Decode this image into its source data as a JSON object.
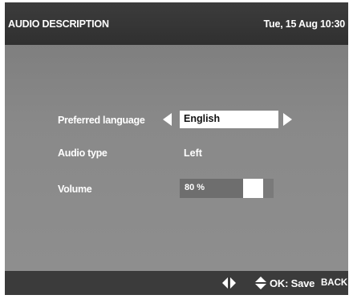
{
  "header": {
    "title": "AUDIO DESCRIPTION",
    "datetime": "Tue, 15 Aug 10:30"
  },
  "settings": {
    "preferred_language": {
      "label": "Preferred language",
      "value": "English"
    },
    "audio_type": {
      "label": "Audio type",
      "value": "Left"
    },
    "volume": {
      "label": "Volume",
      "value_text": "80 %",
      "level_percent": 80
    }
  },
  "footer": {
    "navigate_icon": "left-right-arrows-icon",
    "select_icon": "up-down-arrows-icon",
    "ok_label": "OK: Save",
    "back_label": "BACK"
  },
  "colors": {
    "background": "#8f8f8f",
    "header_bar": "#333333",
    "footer_bar": "#3b3b3b",
    "text": "#ffffff"
  }
}
